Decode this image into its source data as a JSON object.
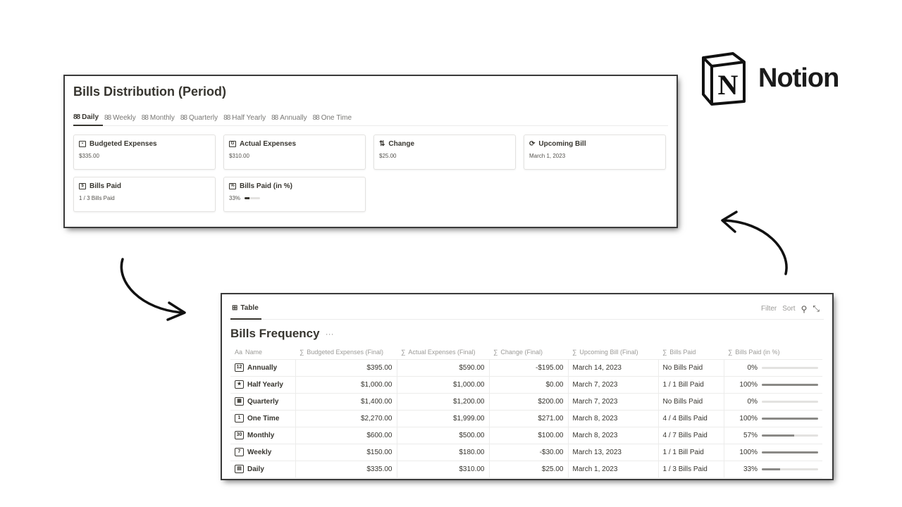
{
  "distribution": {
    "title": "Bills Distribution (Period)",
    "tabs": [
      {
        "label": "Daily",
        "active": true
      },
      {
        "label": "Weekly",
        "active": false
      },
      {
        "label": "Monthly",
        "active": false
      },
      {
        "label": "Quarterly",
        "active": false
      },
      {
        "label": "Half Yearly",
        "active": false
      },
      {
        "label": "Annually",
        "active": false
      },
      {
        "label": "One Time",
        "active": false
      }
    ],
    "cards": [
      {
        "label": "Budgeted Expenses",
        "value": "$335.00",
        "icon": "calendar-icon"
      },
      {
        "label": "Actual Expenses",
        "value": "$310.00",
        "icon": "receipt-icon"
      },
      {
        "label": "Change",
        "value": "$25.00",
        "icon": "swap-arrows-icon"
      },
      {
        "label": "Upcoming Bill",
        "value": "March 1, 2023",
        "icon": "cycle-icon"
      },
      {
        "label": "Bills Paid",
        "value": "1 / 3 Bills Paid",
        "icon": "bill-icon"
      },
      {
        "label": "Bills Paid (in %)",
        "value": "33%",
        "progress": 0.33,
        "icon": "percent-icon"
      }
    ]
  },
  "brand": {
    "name": "Notion",
    "mark": "N"
  },
  "frequency": {
    "view_tab": "Table",
    "tools": {
      "filter": "Filter",
      "sort": "Sort"
    },
    "title": "Bills Frequency",
    "more": "···",
    "columns": [
      "Name",
      "Budgeted Expenses (Final)",
      "Actual Expenses (Final)",
      "Change (Final)",
      "Upcoming Bill (Final)",
      "Bills Paid",
      "Bills Paid (in %)"
    ],
    "column_prefixes": [
      "Aa",
      "∑",
      "∑",
      "∑",
      "∑",
      "∑",
      "∑"
    ],
    "rows": [
      {
        "name": "Annually",
        "icon": "calendar-12-icon",
        "icon_text": "12",
        "budget": "$395.00",
        "actual": "$590.00",
        "change": "-$195.00",
        "upcoming": "March 14, 2023",
        "paid": "No Bills Paid",
        "pct": "0%",
        "progress": 0
      },
      {
        "name": "Half Yearly",
        "icon": "star-half-icon",
        "icon_text": "★",
        "budget": "$1,000.00",
        "actual": "$1,000.00",
        "change": "$0.00",
        "upcoming": "March 7, 2023",
        "paid": "1 / 1 Bill Paid",
        "pct": "100%",
        "progress": 1
      },
      {
        "name": "Quarterly",
        "icon": "calendar-blocks-icon",
        "icon_text": "▦",
        "budget": "$1,400.00",
        "actual": "$1,200.00",
        "change": "$200.00",
        "upcoming": "March 7, 2023",
        "paid": "No Bills Paid",
        "pct": "0%",
        "progress": 0
      },
      {
        "name": "One Time",
        "icon": "calendar-1-icon",
        "icon_text": "1",
        "budget": "$2,270.00",
        "actual": "$1,999.00",
        "change": "$271.00",
        "upcoming": "March 8, 2023",
        "paid": "4 / 4 Bills Paid",
        "pct": "100%",
        "progress": 1
      },
      {
        "name": "Monthly",
        "icon": "calendar-30-icon",
        "icon_text": "30",
        "budget": "$600.00",
        "actual": "$500.00",
        "change": "$100.00",
        "upcoming": "March 8, 2023",
        "paid": "4 / 7 Bills Paid",
        "pct": "57%",
        "progress": 0.57
      },
      {
        "name": "Weekly",
        "icon": "calendar-7-icon",
        "icon_text": "7",
        "budget": "$150.00",
        "actual": "$180.00",
        "change": "-$30.00",
        "upcoming": "March 13, 2023",
        "paid": "1 / 1 Bill Paid",
        "pct": "100%",
        "progress": 1
      },
      {
        "name": "Daily",
        "icon": "calendar-grid-icon",
        "icon_text": "▤",
        "budget": "$335.00",
        "actual": "$310.00",
        "change": "$25.00",
        "upcoming": "March 1, 2023",
        "paid": "1 / 3 Bills Paid",
        "pct": "33%",
        "progress": 0.33
      }
    ]
  }
}
